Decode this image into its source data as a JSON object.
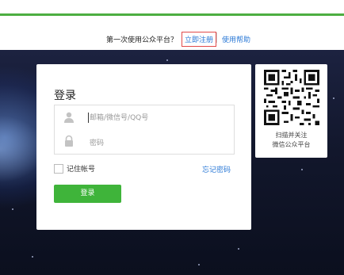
{
  "notice": {
    "text": "第一次使用公众平台？",
    "register_link": "立即注册",
    "help_link": "使用帮助"
  },
  "login": {
    "title": "登录",
    "username_placeholder": "邮箱/微信号/QQ号",
    "password_placeholder": "密码",
    "remember_label": "记住帐号",
    "forgot_link": "忘记密码",
    "submit_label": "登录"
  },
  "qr": {
    "caption_line1": "扫描并关注",
    "caption_line2": "微信公众平台"
  },
  "colors": {
    "accent_green": "#3fb43a",
    "link_blue": "#2a78d6",
    "highlight_red": "#e24a4a",
    "background_dark": "#12172c"
  },
  "icons": {
    "username": "user-icon",
    "password": "lock-icon",
    "qr": "qr-code-icon"
  }
}
